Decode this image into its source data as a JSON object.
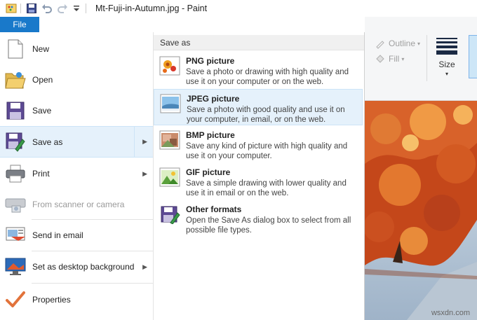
{
  "window": {
    "title": "Mt-Fuji-in-Autumn.jpg - Paint"
  },
  "ribbon": {
    "file_tab": "File",
    "outline_label": "Outline",
    "fill_label": "Fill",
    "size_label": "Size"
  },
  "menu": {
    "items": [
      {
        "label": "New"
      },
      {
        "label": "Open"
      },
      {
        "label": "Save"
      },
      {
        "label": "Save as"
      },
      {
        "label": "Print"
      },
      {
        "label": "From scanner or camera"
      },
      {
        "label": "Send in email"
      },
      {
        "label": "Set as desktop background"
      },
      {
        "label": "Properties"
      }
    ]
  },
  "save_as": {
    "header": "Save as",
    "options": [
      {
        "title": "PNG picture",
        "desc": "Save a photo or drawing with high quality and use it on your computer or on the web."
      },
      {
        "title": "JPEG picture",
        "desc": "Save a photo with good quality and use it on your computer, in email, or on the web."
      },
      {
        "title": "BMP picture",
        "desc": "Save any kind of picture with high quality and use it on your computer."
      },
      {
        "title": "GIF picture",
        "desc": "Save a simple drawing with lower quality and use it in email or on the web."
      },
      {
        "title": "Other formats",
        "desc": "Open the Save As dialog box to select from all possible file types."
      }
    ]
  },
  "watermark": "wsxdn.com",
  "colors": {
    "file_tab": "#1979ca",
    "highlight": "#e5f1fb",
    "highlight_border": "#cce4f7"
  }
}
